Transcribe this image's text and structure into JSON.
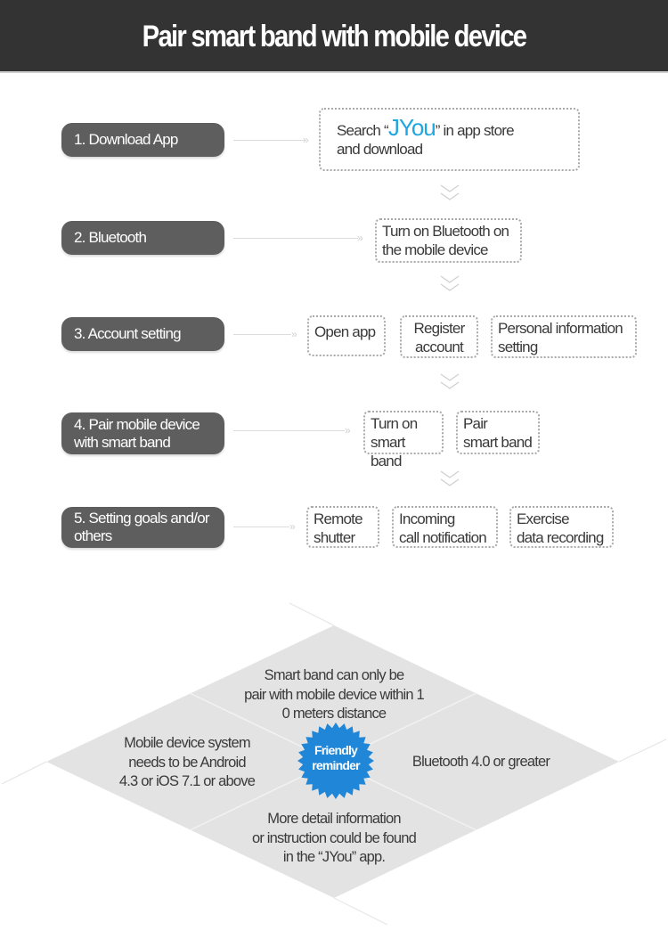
{
  "header": {
    "title": "Pair smart band with mobile device"
  },
  "colors": {
    "header_bg": "#333333",
    "step_bg": "#5e5e5e",
    "accent_blue": "#1fa6e0",
    "badge_blue": "#1f86d8",
    "diamond_fill": "#e3e3e3"
  },
  "steps": [
    {
      "label": "1. Download App",
      "boxes": [
        {
          "prefix": "Search “",
          "brand": "JYou",
          "suffix": "” in app store",
          "line2": "and download"
        }
      ]
    },
    {
      "label": "2. Bluetooth",
      "boxes": [
        {
          "line1": "Turn on Bluetooth on",
          "line2": "the mobile device"
        }
      ]
    },
    {
      "label": "3. Account setting",
      "boxes": [
        {
          "line1": "Open app"
        },
        {
          "line1": "Register",
          "line2": "account"
        },
        {
          "line1": "Personal information",
          "line2": "setting"
        }
      ]
    },
    {
      "label_line1": "4. Pair mobile device",
      "label_line2": "with smart band",
      "boxes": [
        {
          "line1": "Turn on",
          "line2": "smart band"
        },
        {
          "line1": "Pair",
          "line2": "smart band"
        }
      ]
    },
    {
      "label_line1": "5. Setting goals and/or",
      "label_line2": "others",
      "boxes": [
        {
          "line1": "Remote",
          "line2": "shutter"
        },
        {
          "line1": "Incoming",
          "line2": "call notification"
        },
        {
          "line1": "Exercise",
          "line2": "data recording"
        }
      ]
    }
  ],
  "reminder": {
    "badge_line1": "Friendly",
    "badge_line2": "reminder",
    "top": [
      "Smart band can only be",
      "pair with mobile device within 1",
      "0 meters distance"
    ],
    "left": [
      "Mobile device system",
      "needs to be Android",
      "4.3 or iOS 7.1 or above"
    ],
    "right": [
      "Bluetooth 4.0 or greater"
    ],
    "bottom": [
      "More detail information",
      "or instruction could be found",
      "in the “JYou” app."
    ]
  }
}
